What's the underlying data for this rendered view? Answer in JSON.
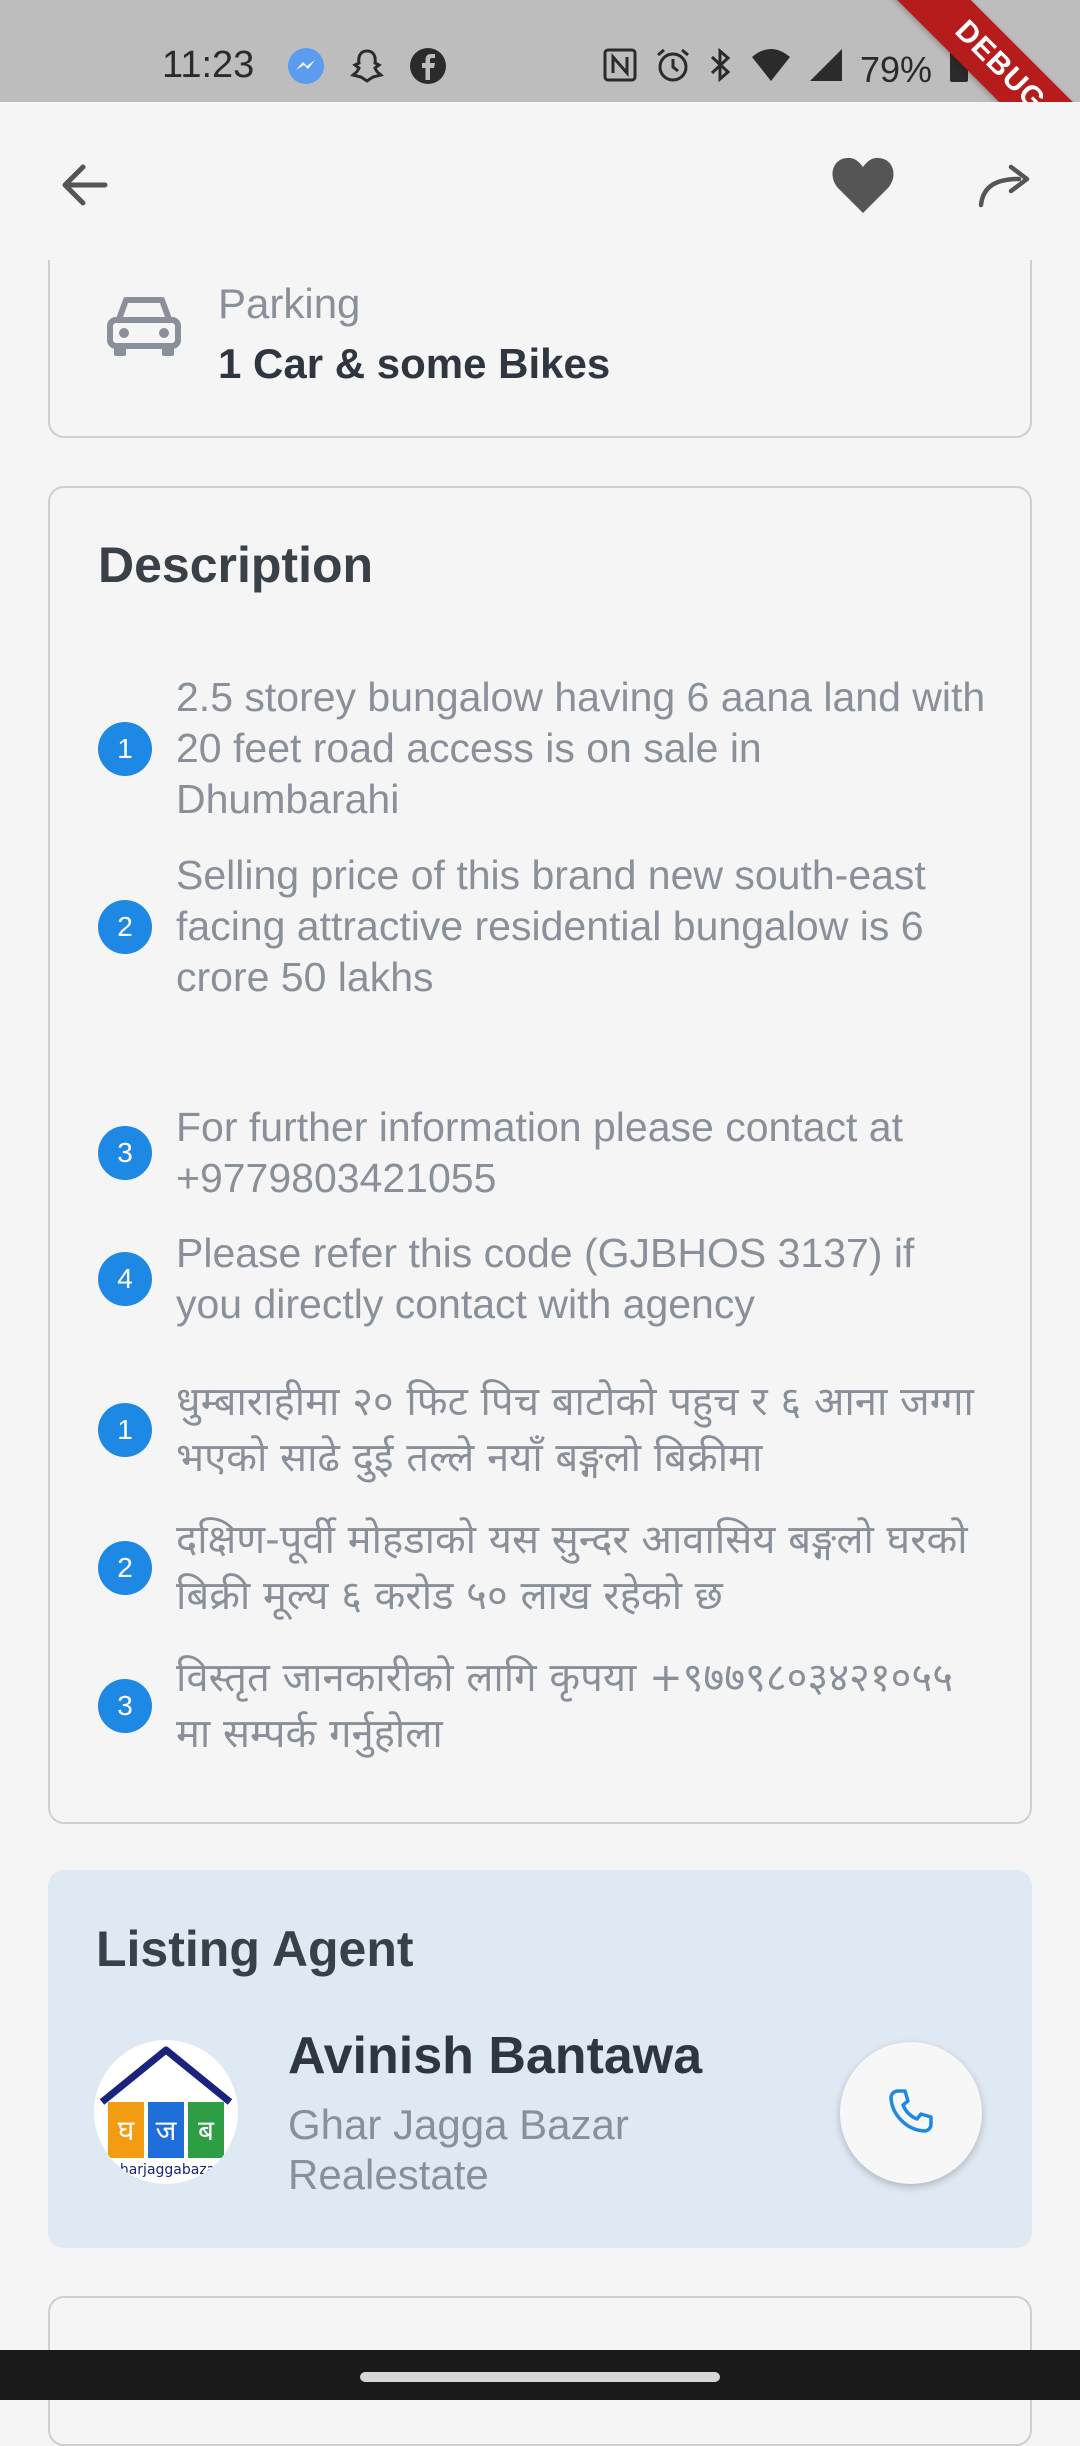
{
  "status_bar": {
    "time": "11:23",
    "battery": "79%",
    "debug_label": "DEBUG"
  },
  "app_bar": {
    "back_icon": "arrow-left-icon",
    "favorite_icon": "heart-icon",
    "share_icon": "share-arrow-icon"
  },
  "parking": {
    "label": "Parking",
    "value": "1 Car & some Bikes",
    "icon": "car-icon"
  },
  "description": {
    "title": "Description",
    "english_items": [
      {
        "num": "1",
        "text": "2.5 storey bungalow having 6 aana land with 20 feet road access is on sale in Dhumbarahi"
      },
      {
        "num": "2",
        "text": "Selling price of this brand new south-east facing attractive residential bungalow is 6 crore 50 lakhs"
      },
      {
        "num": "3",
        "text": "For further information please contact at +9779803421055"
      },
      {
        "num": "4",
        "text": "Please refer this code (GJBHOS 3137) if you directly contact with agency"
      }
    ],
    "nepali_items": [
      {
        "num": "1",
        "text": "धुम्बाराहीमा २० फिट पिच बाटोको पहुच र ६ आना जग्गा भएको साढे दुई तल्ले नयाँ बङ्गलो बिक्रीमा"
      },
      {
        "num": "2",
        "text": "दक्षिण-पूर्वी मोहडाको यस सुन्दर आवासिय बङ्गलो घरको बिक्री मूल्य ६ करोड ५० लाख रहेको छ"
      },
      {
        "num": "3",
        "text": "विस्तृत जानकारीको लागि कृपया +९७७९८०३४२१०५५ मा सम्पर्क गर्नुहोला"
      }
    ]
  },
  "agent": {
    "section_title": "Listing Agent",
    "name": "Avinish Bantawa",
    "company": "Ghar Jagga Bazar Realestate",
    "logo_text": "gharjaggabazar",
    "logo_letters": [
      "घ",
      "ज",
      "ब"
    ],
    "call_icon": "phone-icon"
  },
  "colors": {
    "accent": "#1e88e5",
    "agent_card_bg": "#dfe9f3",
    "debug_ribbon": "#b71c1c"
  }
}
